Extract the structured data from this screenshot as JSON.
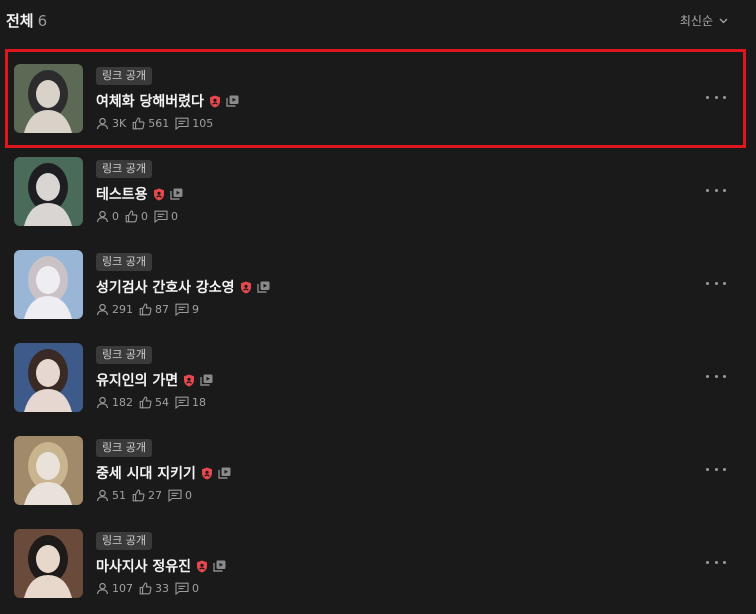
{
  "header": {
    "title": "전체",
    "count": "6",
    "sort_label": "최신순"
  },
  "colors": {
    "background": "#1a1a1a",
    "selected_border": "#e0161f",
    "shield": "#e5484d"
  },
  "items": [
    {
      "badge": "링크 공개",
      "title": "여체화 당해버렸다",
      "views": "3K",
      "likes": "561",
      "comments": "105",
      "thumb_palette": [
        "#5c6a55",
        "#d8d2c8",
        "#2c2b2e"
      ]
    },
    {
      "badge": "링크 공개",
      "title": "테스트용",
      "views": "0",
      "likes": "0",
      "comments": "0",
      "thumb_palette": [
        "#4a6a5a",
        "#d9d5d2",
        "#1d1e22"
      ]
    },
    {
      "badge": "링크 공개",
      "title": "성기검사 간호사 강소영",
      "views": "291",
      "likes": "87",
      "comments": "9",
      "thumb_palette": [
        "#9ab6d6",
        "#eeeef2",
        "#c9c3c8"
      ]
    },
    {
      "badge": "링크 공개",
      "title": "유지인의 가면",
      "views": "182",
      "likes": "54",
      "comments": "18",
      "thumb_palette": [
        "#3d5a8a",
        "#e6d8d0",
        "#3a2a26"
      ]
    },
    {
      "badge": "링크 공개",
      "title": "중세 시대 지키기",
      "views": "51",
      "likes": "27",
      "comments": "0",
      "thumb_palette": [
        "#a08a6a",
        "#e8e2da",
        "#c8b48e"
      ]
    },
    {
      "badge": "링크 공개",
      "title": "마사지사 정유진",
      "views": "107",
      "likes": "33",
      "comments": "0",
      "thumb_palette": [
        "#6a4a3a",
        "#e8d8cc",
        "#1e1a1a"
      ]
    }
  ]
}
